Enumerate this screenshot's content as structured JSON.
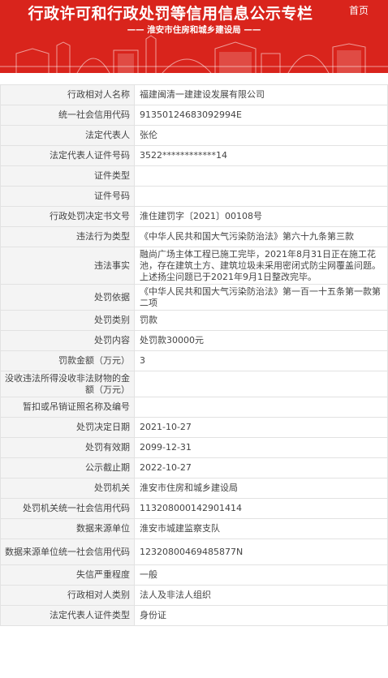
{
  "header": {
    "title": "行政许可和行政处罚等信用信息公示专栏",
    "home_label": "首页",
    "subtitle": "—— 淮安市住房和城乡建设局 ——"
  },
  "rows": [
    {
      "label": "行政相对人名称",
      "value": "福建闽清一建建设发展有限公司",
      "h": "h1"
    },
    {
      "label": "统一社会信用代码",
      "value": "91350124683092994E",
      "h": "h1"
    },
    {
      "label": "法定代表人",
      "value": "张伦",
      "h": "h1"
    },
    {
      "label": "法定代表人证件号码",
      "value": "3522************14",
      "h": "h1"
    },
    {
      "label": "证件类型",
      "value": "",
      "h": "h1"
    },
    {
      "label": "证件号码",
      "value": "",
      "h": "h1"
    },
    {
      "label": "行政处罚决定书文号",
      "value": "淮住建罚字〔2021〕00108号",
      "h": "h1"
    },
    {
      "label": "违法行为类型",
      "value": "《中华人民共和国大气污染防治法》第六十九条第三款",
      "h": "h1"
    },
    {
      "label": "违法事实",
      "value": "融尚广场主体工程已施工完毕，2021年8月31日正在施工花池，存在建筑土方、建筑垃圾未采用密闭式防尘网覆盖问题。上述扬尘问题已于2021年9月1日整改完毕。",
      "h": "h3"
    },
    {
      "label": "处罚依据",
      "value": "《中华人民共和国大气污染防治法》第一百一十五条第一款第二项",
      "h": "h2"
    },
    {
      "label": "处罚类别",
      "value": "罚款",
      "h": "h1"
    },
    {
      "label": "处罚内容",
      "value": "处罚款30000元",
      "h": "h1"
    },
    {
      "label": "罚款金额（万元）",
      "value": "3",
      "h": "h1"
    },
    {
      "label": "没收违法所得没收非法财物的金额（万元）",
      "value": "",
      "h": "h2"
    },
    {
      "label": "暂扣或吊销证照名称及编号",
      "value": "",
      "h": "h1"
    },
    {
      "label": "处罚决定日期",
      "value": "2021-10-27",
      "h": "h1"
    },
    {
      "label": "处罚有效期",
      "value": "2099-12-31",
      "h": "h1"
    },
    {
      "label": "公示截止期",
      "value": "2022-10-27",
      "h": "h1"
    },
    {
      "label": "处罚机关",
      "value": "淮安市住房和城乡建设局",
      "h": "h1"
    },
    {
      "label": "处罚机关统一社会信用代码",
      "value": "11320800014290141​4",
      "h": "h1"
    },
    {
      "label": "数据来源单位",
      "value": "淮安市城建监察支队",
      "h": "h1"
    },
    {
      "label": "数据来源单位统一社会信用代码",
      "value": "12320800469485877N",
      "h": "h2"
    },
    {
      "label": "失信严重程度",
      "value": "一般",
      "h": "h1"
    },
    {
      "label": "行政相对人类别",
      "value": "法人及非法人组织",
      "h": "h1"
    },
    {
      "label": "法定代表人证件类型",
      "value": "身份证",
      "h": "h1"
    }
  ]
}
